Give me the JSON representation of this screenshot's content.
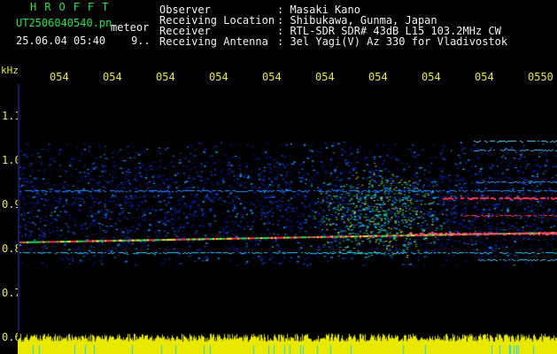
{
  "header": {
    "logo": "HROFFT",
    "filename": "UT2506040540.pn",
    "meteor_label": "meteor",
    "date_time": "25.06.04 05:40",
    "count": "9.."
  },
  "station": {
    "observer_label": "Observer",
    "observer": ": Masaki Kano",
    "location_label": "Receiving Location",
    "location": ": Shibukawa, Gunma, Japan",
    "receiver_label": "Receiver",
    "receiver": ": RTL-SDR SDR# 43dB L15 103.2MHz CW",
    "antenna_label": "Receiving Antenna",
    "antenna": ": 3el Yagi(V) Az 330 for Vladivostok"
  },
  "axis": {
    "unit": "kHz",
    "y_ticks": [
      "1.1",
      "1.0",
      "0.9",
      "0.8",
      "0.7",
      "0.6"
    ],
    "x_ticks": [
      "054",
      "054",
      "054",
      "054",
      "054",
      "054",
      "054",
      "054",
      "054",
      "0550"
    ]
  },
  "colors": {
    "text_green": "#22e34a",
    "text_white": "#f2f2f2",
    "text_yellow": "#e7e84a",
    "background": "#000000",
    "spectrogram_base": "#00005a"
  }
}
